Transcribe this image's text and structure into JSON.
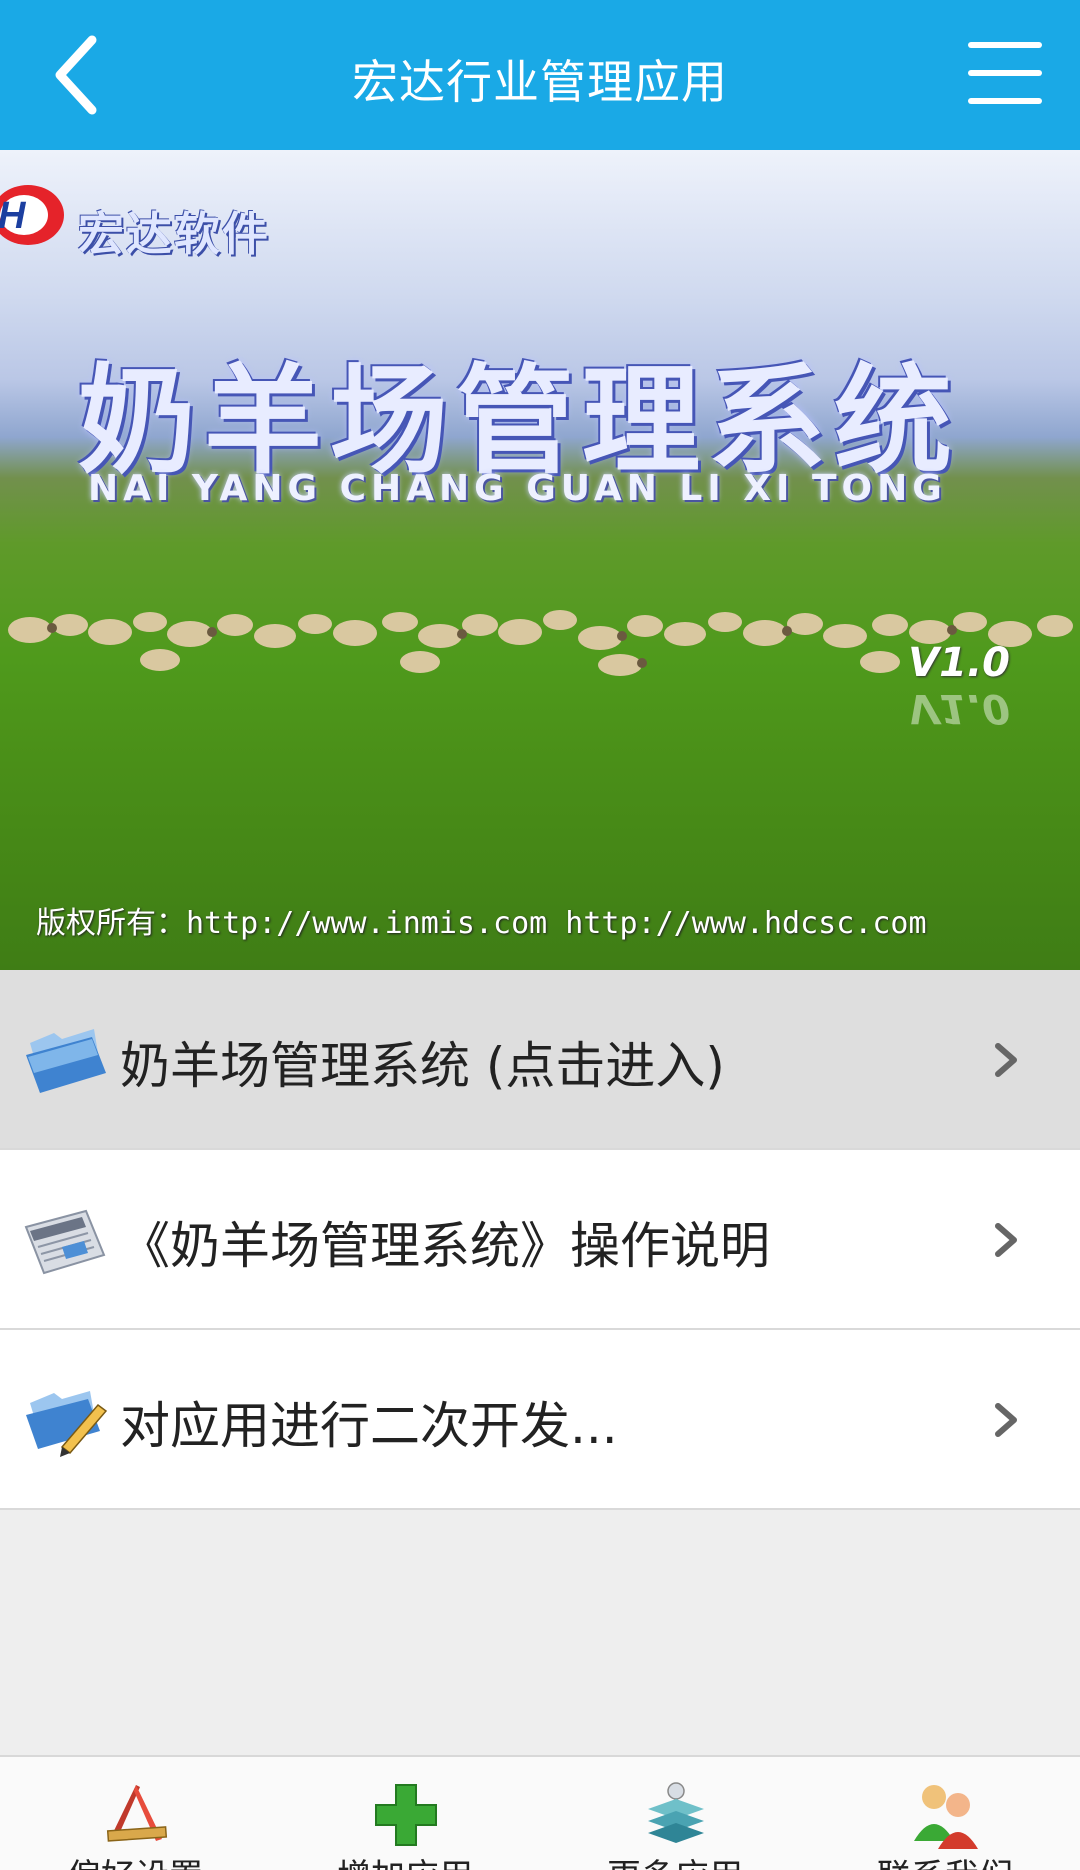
{
  "header": {
    "title": "宏达行业管理应用",
    "back_icon": "chevron-left-icon",
    "menu_icon": "hamburger-menu-icon",
    "background_color": "#1aa9e6"
  },
  "banner": {
    "brand": "宏达软件",
    "title": "奶羊场管理系统",
    "pinyin": "NAI YANG CHANG GUAN LI XI TONG",
    "version": "V1.0",
    "copyright": "版权所有：http://www.inmis.com  http://www.hdcsc.com"
  },
  "list": {
    "items": [
      {
        "label": "奶羊场管理系统 (点击进入)",
        "icon": "folder-icon",
        "active": true
      },
      {
        "label": "《奶羊场管理系统》操作说明",
        "icon": "newspaper-icon",
        "active": false
      },
      {
        "label": "对应用进行二次开发...",
        "icon": "folder-pencil-icon",
        "active": false
      }
    ],
    "chevron_icon": "chevron-right-icon"
  },
  "tabbar": {
    "tabs": [
      {
        "label": "偏好设置",
        "icon": "design-tools-icon"
      },
      {
        "label": "增加应用",
        "icon": "plus-icon"
      },
      {
        "label": "更多应用",
        "icon": "books-icon"
      },
      {
        "label": "联系我们",
        "icon": "contacts-icon"
      }
    ]
  }
}
